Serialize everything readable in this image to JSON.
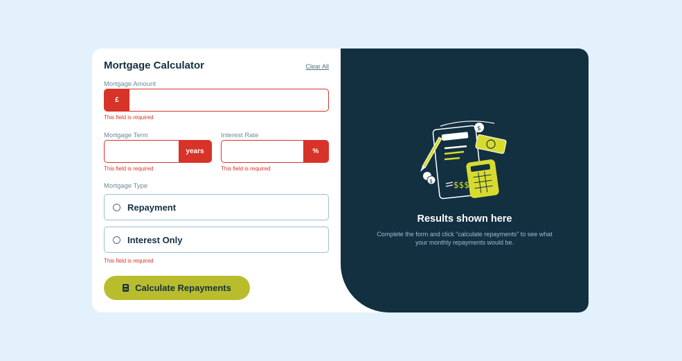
{
  "form": {
    "title": "Mortgage Calculator",
    "clear_label": "Clear All",
    "amount": {
      "label": "Mortgage Amount",
      "prefix": "£",
      "value": "",
      "error": "This field is required"
    },
    "term": {
      "label": "Mortgage Term",
      "suffix": "years",
      "value": "",
      "error": "This field is required"
    },
    "rate": {
      "label": "Interest Rate",
      "suffix": "%",
      "value": "",
      "error": "This field is required"
    },
    "type": {
      "label": "Mortgage Type",
      "options": [
        "Repayment",
        "Interest Only"
      ],
      "error": "This field is required"
    },
    "submit_label": "Calculate Repayments"
  },
  "results": {
    "title": "Results shown here",
    "text": "Complete the form and click “calculate repayments” to see what your monthly repayments would be."
  },
  "colors": {
    "page_bg": "#e2f1fc",
    "panel_dark": "#133040",
    "accent_lime": "#b9bd2d",
    "error_red": "#d73328"
  },
  "icons": [
    "calculator-icon",
    "empty-results-illustration"
  ]
}
